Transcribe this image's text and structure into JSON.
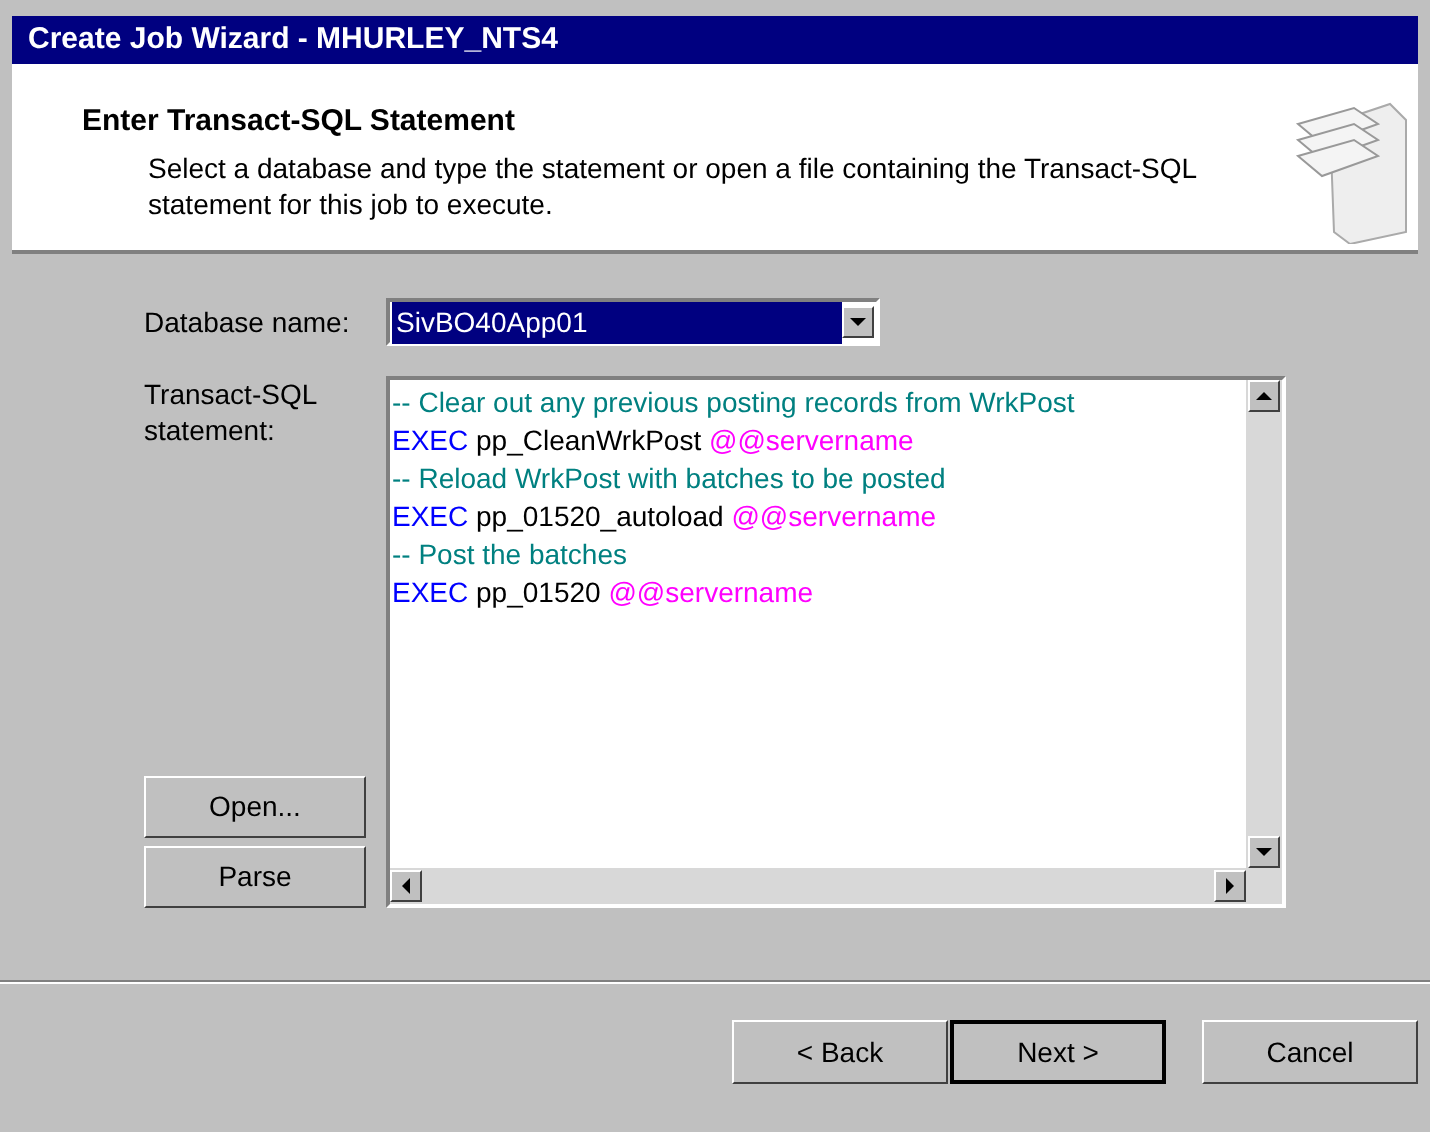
{
  "window": {
    "title": "Create Job Wizard - MHURLEY_NTS4"
  },
  "header": {
    "title": "Enter Transact-SQL Statement",
    "description": "Select a database and type the statement or open a file containing the Transact-SQL statement for this job to execute."
  },
  "database": {
    "label": "Database name:",
    "value": "SivBO40App01",
    "highlighted": true
  },
  "statement": {
    "label": "Transact-SQL statement:",
    "lines": [
      [
        {
          "kind": "comment",
          "text": "-- Clear out any previous posting records from WrkPost"
        }
      ],
      [
        {
          "kind": "keyword",
          "text": "EXEC"
        },
        {
          "kind": "plain",
          "text": "pp_CleanWrkPost"
        },
        {
          "kind": "variable",
          "text": "@@servername"
        }
      ],
      [
        {
          "kind": "comment",
          "text": "-- Reload WrkPost with batches to be posted"
        }
      ],
      [
        {
          "kind": "keyword",
          "text": "EXEC"
        },
        {
          "kind": "plain",
          "text": "pp_01520_autoload"
        },
        {
          "kind": "variable",
          "text": "@@servername"
        }
      ],
      [
        {
          "kind": "comment",
          "text": "-- Post the batches"
        }
      ],
      [
        {
          "kind": "keyword",
          "text": "EXEC"
        },
        {
          "kind": "plain",
          "text": "pp_01520"
        },
        {
          "kind": "variable",
          "text": "@@servername"
        }
      ]
    ]
  },
  "side_buttons": [
    {
      "label": "Open..."
    },
    {
      "label": "Parse"
    }
  ],
  "footer_buttons": [
    {
      "label": "< Back",
      "default": false
    },
    {
      "label": "Next >",
      "default": true
    },
    {
      "label": "Cancel",
      "default": false
    }
  ]
}
